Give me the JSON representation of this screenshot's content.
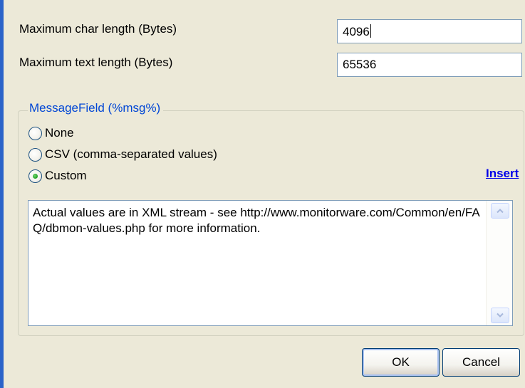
{
  "fields": {
    "max_char_label": "Maximum char length (Bytes)",
    "max_char_value": "4096",
    "max_text_label": "Maximum text length (Bytes)",
    "max_text_value": "65536"
  },
  "message_field": {
    "title": "MessageField (%msg%)",
    "options": [
      {
        "label": "None",
        "checked": false
      },
      {
        "label": "CSV (comma-separated values)",
        "checked": false
      },
      {
        "label": "Custom",
        "checked": true
      }
    ],
    "insert_label": "Insert",
    "custom_text": "Actual values are in XML stream - see http://www.monitorware.com/Common/en/FAQ/dbmon-values.php for more information."
  },
  "buttons": {
    "ok_label": "OK",
    "cancel_label": "Cancel"
  },
  "icons": {
    "scroll_up": "chevron-up-icon",
    "scroll_down": "chevron-down-icon"
  },
  "colors": {
    "window_background": "#ece9d8",
    "group_title": "#0046d5",
    "link": "#0000e8",
    "radio_selected": "#21a121",
    "accent_edge": "#2b63c9"
  }
}
